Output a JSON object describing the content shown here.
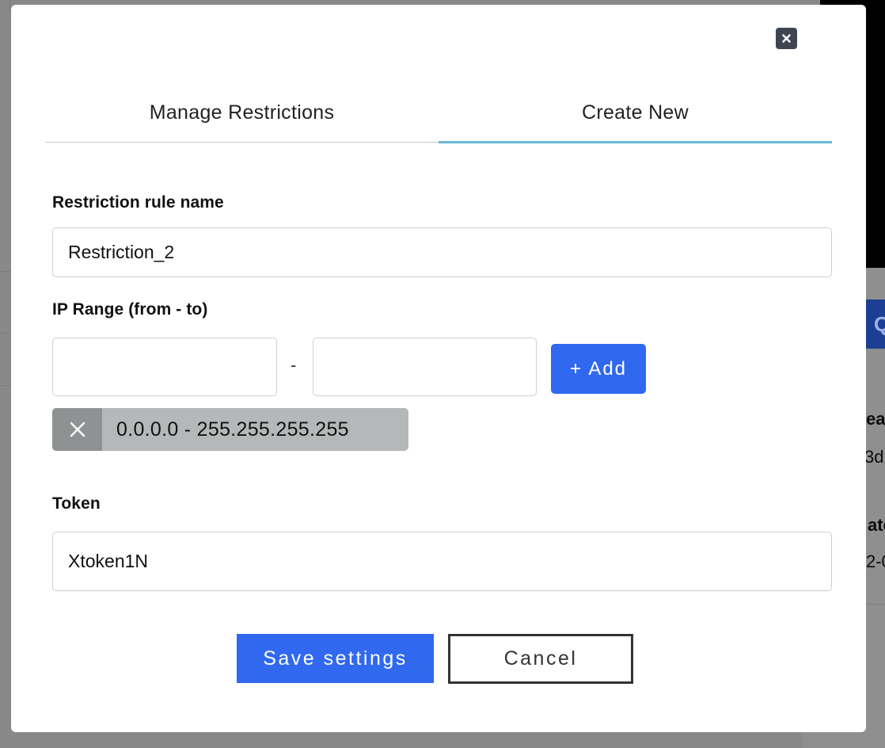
{
  "background": {
    "button_fragment": "Q",
    "text_fragments": [
      "ea",
      "3d",
      "ate",
      "2-0"
    ]
  },
  "dialog": {
    "close_icon": "close-icon",
    "tabs": [
      {
        "label": "Manage Restrictions",
        "active": false
      },
      {
        "label": "Create New",
        "active": true
      }
    ],
    "rule_name": {
      "label": "Restriction rule name",
      "value": "Restriction_2"
    },
    "ip_range": {
      "label": "IP Range (from - to)",
      "from_value": "",
      "to_value": "",
      "separator": "-",
      "add_label": "+ Add",
      "entries": [
        {
          "range": "0.0.0.0 - 255.255.255.255",
          "remove_icon": "x-icon"
        }
      ]
    },
    "token": {
      "label": "Token",
      "value": "Xtoken1N"
    },
    "actions": {
      "save_label": "Save settings",
      "cancel_label": "Cancel"
    },
    "colors": {
      "primary": "#3069f0",
      "tab_indicator": "#6bb9d8",
      "close_bg": "#3e4550",
      "chip_bg": "#b4b8b8",
      "chip_remove_bg": "#8e9292"
    }
  }
}
